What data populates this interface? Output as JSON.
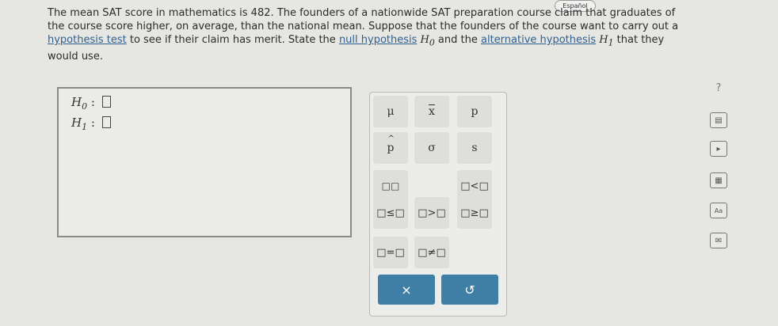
{
  "language_button": "Español",
  "question": {
    "text_1": "The mean SAT score in mathematics is 482. The founders of a nationwide SAT preparation course claim that graduates of the course score higher, on average, than the national mean. Suppose that the founders of the course want to carry out a ",
    "link_hypothesis_test": "hypothesis test",
    "text_2": " to see if their claim has merit. State the ",
    "link_null": "null hypothesis",
    "h0_symbol": "H",
    "h0_sub": "0",
    "text_3": " and the ",
    "link_alternative": "alternative hypothesis",
    "h1_symbol": "H",
    "h1_sub": "1",
    "text_4": " that they would use."
  },
  "answer": {
    "h0_label": "H",
    "h0_sub": "0",
    "h1_label": "H",
    "h1_sub": "1",
    "colon": ":"
  },
  "palette": {
    "mu": "μ",
    "xbar": "x",
    "p": "p",
    "phat": "p",
    "sigma": "σ",
    "s": "s",
    "superscript": "□□",
    "lt": "□<□",
    "le": "□≤□",
    "gt": "□>□",
    "ge": "□≥□",
    "eq": "□=□",
    "ne": "□≠□",
    "clear": "×",
    "undo": "↺"
  },
  "sidebar": {
    "help": "?",
    "book": "▤",
    "play": "▸",
    "calc": "▦",
    "dict": "Aa",
    "mail": "✉"
  },
  "colors": {
    "accent": "#3f7fa5",
    "link": "#2f5f8f"
  }
}
